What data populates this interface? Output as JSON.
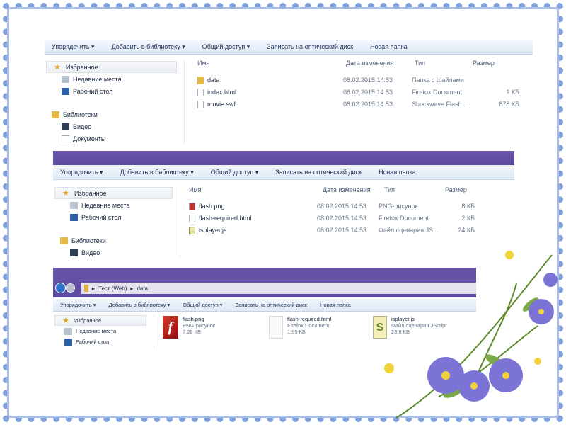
{
  "toolbar": {
    "organize": "Упорядочить ▾",
    "add_library": "Добавить в библиотеку ▾",
    "share": "Общий доступ ▾",
    "burn": "Записать на оптический диск",
    "new_folder": "Новая папка"
  },
  "sidebar": {
    "favorites": "Избранное",
    "recent": "Недавние места",
    "desktop": "Рабочий стол",
    "libraries": "Библиотеки",
    "video": "Видео",
    "documents": "Документы"
  },
  "columns": {
    "name": "Имя",
    "date": "Дата изменения",
    "type": "Тип",
    "size": "Размер"
  },
  "window1": {
    "files": [
      {
        "name": "data",
        "date": "08.02.2015 14:53",
        "type": "Папка с файлами",
        "size": "",
        "icon": "folder-icon"
      },
      {
        "name": "index.html",
        "date": "08.02.2015 14:53",
        "type": "Firefox Document",
        "size": "1 КБ",
        "icon": "file-icon"
      },
      {
        "name": "movie.swf",
        "date": "08.02.2015 14:53",
        "type": "Shockwave Flash ...",
        "size": "878 КБ",
        "icon": "file-icon"
      }
    ]
  },
  "window2": {
    "files": [
      {
        "name": "flash.png",
        "date": "08.02.2015 14:53",
        "type": "PNG-рисунок",
        "size": "8 КБ",
        "icon": "image-icon"
      },
      {
        "name": "flash-required.html",
        "date": "08.02.2015 14:53",
        "type": "Firefox Document",
        "size": "2 КБ",
        "icon": "file-icon"
      },
      {
        "name": "isplayer.js",
        "date": "08.02.2015 14:53",
        "type": "Файл сценария JS...",
        "size": "24 КБ",
        "icon": "script-icon"
      }
    ]
  },
  "window3": {
    "breadcrumb": [
      "Тест (Web)",
      "data"
    ],
    "tiles": [
      {
        "name": "flash.png",
        "type": "PNG-рисунок",
        "size": "7,28 КБ"
      },
      {
        "name": "flash-required.html",
        "type": "Firefox Document",
        "size": "1,95 КБ"
      },
      {
        "name": "isplayer.js",
        "type": "Файл сценария JScript",
        "size": "23,8 КБ"
      }
    ]
  }
}
